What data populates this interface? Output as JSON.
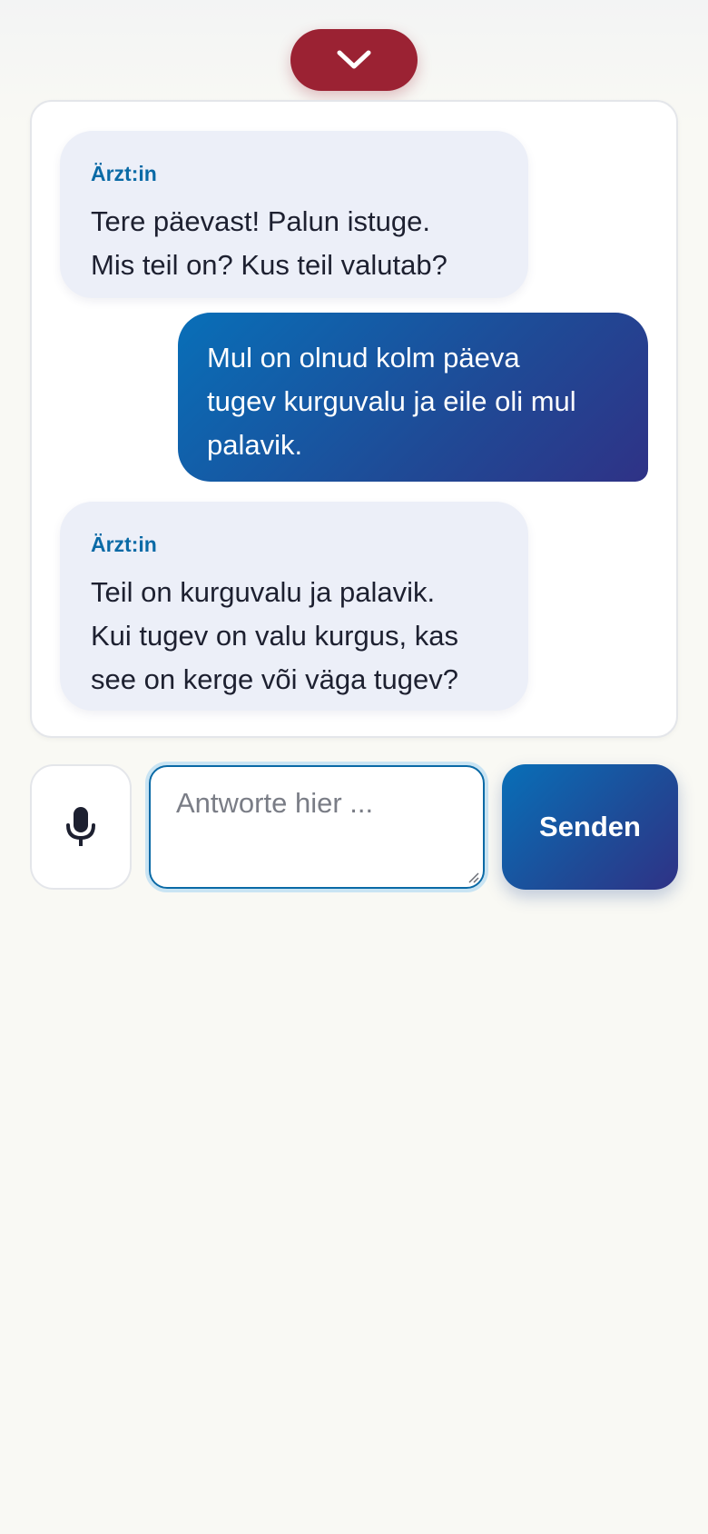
{
  "controls": {
    "collapse_icon": "chevron-down-icon",
    "mic_icon": "microphone-icon",
    "send_label": "Senden",
    "input_placeholder": "Antworte hier ...",
    "input_value": ""
  },
  "messages": [
    {
      "role": "doctor",
      "sender": "Ärzt:in",
      "lines": [
        "Tere päevast! Palun istuge.",
        "Mis teil on? Kus teil valutab?"
      ]
    },
    {
      "role": "user",
      "lines": [
        "Mul on olnud kolm päeva",
        "tugev kurguvalu ja eile oli mul",
        "palavik."
      ]
    },
    {
      "role": "doctor",
      "sender": "Ärzt:in",
      "lines": [
        "Teil on kurguvalu ja palavik.",
        "Kui tugev on valu kurgus, kas",
        "see on kerge või väga tugev?"
      ]
    }
  ],
  "colors": {
    "accent_red": "#9b2233",
    "brand_blue": "#0a6aa6",
    "gradient_start": "#086fb8",
    "gradient_end": "#2f3286",
    "doctor_bubble": "#eceff8",
    "page_background": "#f9f9f4"
  }
}
